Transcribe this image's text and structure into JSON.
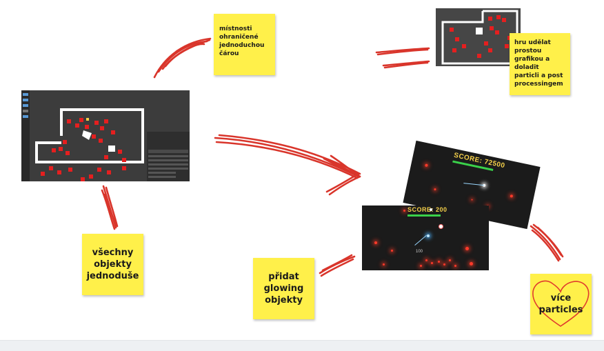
{
  "notes": {
    "rooms": "místnosti ohraničené jednoduchou čárou",
    "graphics": "hru udělat prostou grafikou a doladit particli a post processingem",
    "objects": "všechny objekty jednoduše",
    "glowing": "přidat glowing objekty",
    "particles": "více particles"
  },
  "game_top": {
    "score": "SCORE: 72500"
  },
  "game_bottom": {
    "score": "SCORE: 200",
    "label": "100"
  },
  "colors": {
    "sticky": "#fff04a",
    "arrow": "#d9352b",
    "editor_bg": "#3c3c3c",
    "game_bg": "#1b1b1b",
    "enemy": "#e51f1f",
    "health": "#3ad14a",
    "score": "#f5d04a"
  }
}
